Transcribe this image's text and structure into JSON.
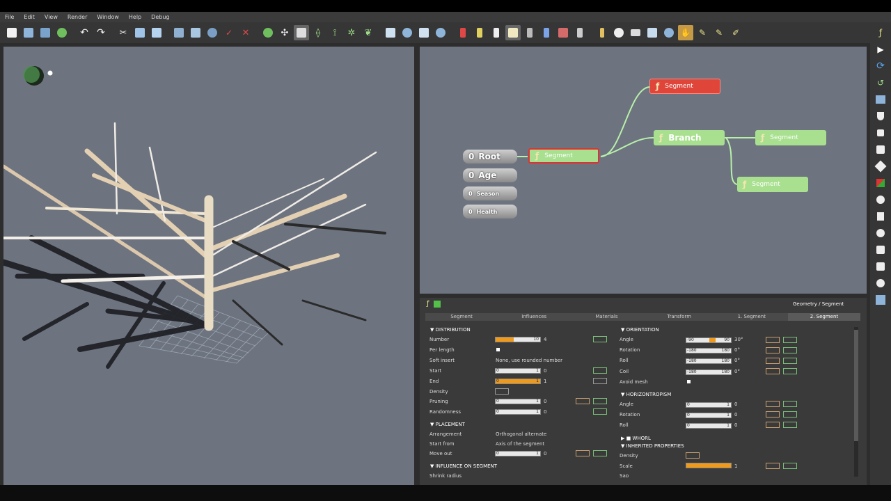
{
  "menu": [
    "File",
    "Edit",
    "View",
    "Render",
    "Window",
    "Help",
    "Debug"
  ],
  "graph": {
    "nodes": {
      "segment_top": "Segment",
      "segment_mid": "Segment",
      "branch": "Branch",
      "segment_right": "Segment",
      "segment_lower": "Segment"
    },
    "inputs": [
      {
        "value": "0",
        "label": "Root"
      },
      {
        "value": "0",
        "label": "Age"
      },
      {
        "value": "0",
        "label": "Season"
      },
      {
        "value": "0",
        "label": "Health"
      }
    ]
  },
  "properties": {
    "breadcrumb": "Geometry / Segment",
    "tabs": [
      "Segment",
      "Influences",
      "Materials",
      "Transform",
      "1. Segment",
      "2. Segment"
    ],
    "active_tab": "2. Segment",
    "left": {
      "distribution_title": "DISTRIBUTION",
      "number_label": "Number",
      "number_max": "10",
      "number_value": "4",
      "number_fill": 0.4,
      "per_length_label": "Per length",
      "soft_insert_label": "Soft insert",
      "soft_insert_value": "None, use rounded number",
      "start_label": "Start",
      "start_min": "0",
      "start_max": "1",
      "start_value": "0",
      "end_label": "End",
      "end_min": "0",
      "end_max": "1",
      "end_value": "1",
      "end_fill": 1.0,
      "density_label": "Density",
      "pruning_label": "Pruning",
      "pruning_min": "0",
      "pruning_max": "1",
      "pruning_value": "0",
      "randomness_label": "Randomness",
      "randomness_min": "0",
      "randomness_max": "1",
      "randomness_value": "0",
      "placement_title": "PLACEMENT",
      "arrangement_label": "Arrangement",
      "arrangement_value": "Orthogonal alternate",
      "start_from_label": "Start from",
      "start_from_value": "Axis of the segment",
      "move_out_label": "Move out",
      "move_out_min": "0",
      "move_out_max": "1",
      "move_out_value": "0",
      "influence_title": "INFLUENCE ON SEGMENT",
      "shrink_label": "Shrink radius"
    },
    "right": {
      "orientation_title": "ORIENTATION",
      "angle_label": "Angle",
      "angle_min": "-90",
      "angle_max": "90",
      "angle_value": "30°",
      "rotation_label": "Rotation",
      "rotation_min": "-180",
      "rotation_max": "180",
      "rotation_value": "0°",
      "roll_label": "Roll",
      "roll_min": "-180",
      "roll_max": "180",
      "roll_value": "0°",
      "coil_label": "Coil",
      "coil_min": "-180",
      "coil_max": "180",
      "coil_value": "0°",
      "avoid_label": "Avoid mesh",
      "horizontropism_title": "HORIZONTROPISM",
      "h_angle_label": "Angle",
      "h_angle_min": "0",
      "h_angle_max": "1",
      "h_angle_value": "0",
      "h_rotation_label": "Rotation",
      "h_rotation_min": "0",
      "h_rotation_max": "1",
      "h_rotation_value": "0",
      "h_roll_label": "Roll",
      "h_roll_min": "0",
      "h_roll_max": "1",
      "h_roll_value": "0",
      "whorl_title": "WHORL",
      "inherited_title": "INHERITED PROPERTIES",
      "inh_density_label": "Density",
      "scale_label": "Scale",
      "scale_value": "1",
      "sap_label": "Sap"
    }
  },
  "colors": {
    "accent": "#f09a1c",
    "node_red": "#e0453a",
    "node_green": "#a8e08f",
    "wire": "#b9f0a9"
  }
}
